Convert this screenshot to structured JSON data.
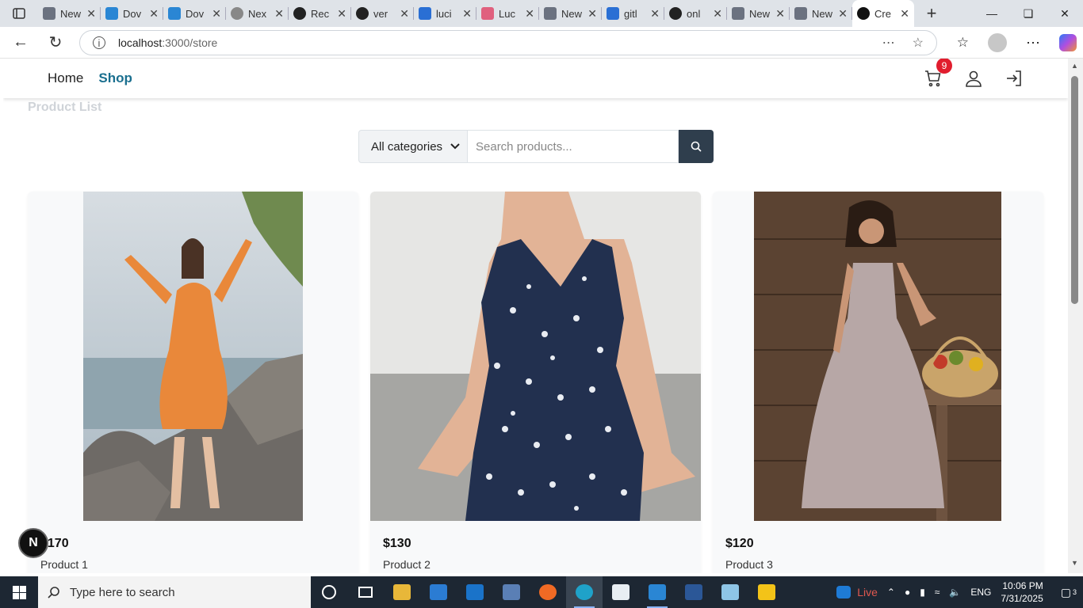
{
  "browser": {
    "tabs": [
      {
        "label": "New",
        "icon": "page-icon",
        "color": "#6b7280"
      },
      {
        "label": "Dov",
        "icon": "vscode-icon",
        "color": "#2a86d4"
      },
      {
        "label": "Dov",
        "icon": "vscode-icon",
        "color": "#2a86d4"
      },
      {
        "label": "Nex",
        "icon": "openai-icon",
        "color": "#888888"
      },
      {
        "label": "Rec",
        "icon": "openai-icon",
        "color": "#222222"
      },
      {
        "label": "ver",
        "icon": "github-icon",
        "color": "#222222"
      },
      {
        "label": "luci",
        "icon": "search-icon",
        "color": "#2a6fd4"
      },
      {
        "label": "Luc",
        "icon": "lucide-icon",
        "color": "#e0607e"
      },
      {
        "label": "New",
        "icon": "page-icon",
        "color": "#6b7280"
      },
      {
        "label": "gitl",
        "icon": "search-icon",
        "color": "#2a6fd4"
      },
      {
        "label": "onl",
        "icon": "github-icon",
        "color": "#222222"
      },
      {
        "label": "New",
        "icon": "page-icon",
        "color": "#6b7280"
      },
      {
        "label": "New",
        "icon": "page-icon",
        "color": "#6b7280"
      },
      {
        "label": "Cre",
        "icon": "nextjs-icon",
        "color": "#111111",
        "active": true
      }
    ],
    "url_host": "localhost",
    "url_path": ":3000/store"
  },
  "site": {
    "nav": {
      "home": "Home",
      "shop": "Shop"
    },
    "cart_count": "9",
    "page_title": "Product List",
    "category_select": "All categories",
    "search_placeholder": "Search products...",
    "accent": "#1a6f8f"
  },
  "products": [
    {
      "price": "$170",
      "name": "Product 1"
    },
    {
      "price": "$130",
      "name": "Product 2"
    },
    {
      "price": "$120",
      "name": "Product 3"
    }
  ],
  "dev_badge": "N",
  "taskbar": {
    "search_placeholder": "Type here to search",
    "live": "Live",
    "lang": "ENG",
    "time": "10:06 PM",
    "date": "7/31/2025",
    "notifications": "3"
  }
}
